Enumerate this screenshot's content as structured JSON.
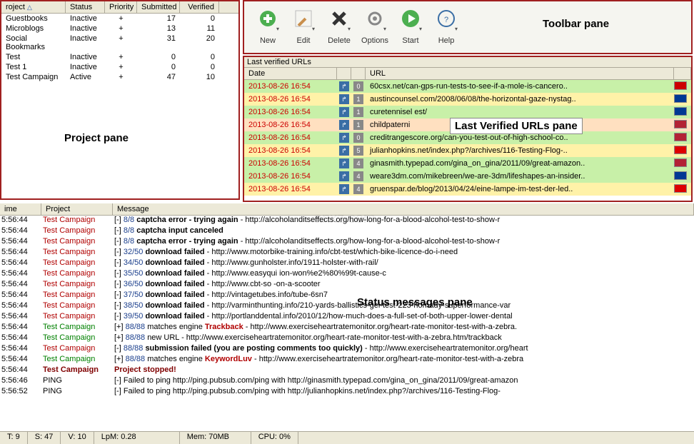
{
  "project_pane": {
    "label": "Project pane",
    "headers": {
      "project": "roject",
      "status": "Status",
      "priority": "Priority",
      "submitted": "Submitted",
      "verified": "Verified"
    },
    "rows": [
      {
        "project": "Guestbooks",
        "status": "Inactive",
        "priority": "+",
        "submitted": "17",
        "verified": "0"
      },
      {
        "project": "Microblogs",
        "status": "Inactive",
        "priority": "+",
        "submitted": "13",
        "verified": "11"
      },
      {
        "project": "Social Bookmarks",
        "status": "Inactive",
        "priority": "+",
        "submitted": "31",
        "verified": "20"
      },
      {
        "project": "Test",
        "status": "Inactive",
        "priority": "+",
        "submitted": "0",
        "verified": "0"
      },
      {
        "project": "Test 1",
        "status": "Inactive",
        "priority": "+",
        "submitted": "0",
        "verified": "0"
      },
      {
        "project": "Test Campaign",
        "status": "Active",
        "priority": "+",
        "submitted": "47",
        "verified": "10"
      }
    ]
  },
  "toolbar": {
    "label": "Toolbar pane",
    "buttons": [
      {
        "name": "new-button",
        "label": "New",
        "icon": "plus",
        "color": "#4caf50"
      },
      {
        "name": "edit-button",
        "label": "Edit",
        "icon": "pencil",
        "color": "#888"
      },
      {
        "name": "delete-button",
        "label": "Delete",
        "icon": "x",
        "color": "#555"
      },
      {
        "name": "options-button",
        "label": "Options",
        "icon": "gear",
        "color": "#888"
      },
      {
        "name": "start-button",
        "label": "Start",
        "icon": "play",
        "color": "#4caf50"
      },
      {
        "name": "help-button",
        "label": "Help",
        "icon": "help",
        "color": "#3a6ea5"
      }
    ]
  },
  "urls_pane": {
    "label": "Last Verified URLs pane",
    "title": "Last verified URLs",
    "headers": {
      "date": "Date",
      "url": "URL"
    },
    "rows": [
      {
        "date": "2013-08-26 16:54",
        "n": "0",
        "url": "60csx.net/can-gps-run-tests-to-see-if-a-mole-is-cancero..",
        "bg": "row-green",
        "flag": "#c00"
      },
      {
        "date": "2013-08-26 16:54",
        "n": "1",
        "url": "austincounsel.com/2008/06/08/the-horizontal-gaze-nystag..",
        "bg": "row-yellow",
        "flag": "#003893"
      },
      {
        "date": "2013-08-26 16:54",
        "n": "1",
        "url": "curetennisel                                    est/",
        "bg": "row-green",
        "flag": "#003893"
      },
      {
        "date": "2013-08-26 16:54",
        "n": "1",
        "url": "childpaterni",
        "bg": "row-peach",
        "flag": "#b22234"
      },
      {
        "date": "2013-08-26 16:54",
        "n": "0",
        "url": "creditrangescore.org/can-you-test-out-of-high-school-co..",
        "bg": "row-green",
        "flag": "#b22234"
      },
      {
        "date": "2013-08-26 16:54",
        "n": "5",
        "url": "julianhopkins.net/index.php?/archives/116-Testing-Flog-..",
        "bg": "row-yellow",
        "flag": "#d00"
      },
      {
        "date": "2013-08-26 16:54",
        "n": "4",
        "url": "ginasmith.typepad.com/gina_on_gina/2011/09/great-amazon..",
        "bg": "row-green",
        "flag": "#b22234"
      },
      {
        "date": "2013-08-26 16:54",
        "n": "4",
        "url": "weare3dm.com/mikebreen/we-are-3dm/lifeshapes-an-insider..",
        "bg": "row-green",
        "flag": "#003893"
      },
      {
        "date": "2013-08-26 16:54",
        "n": "4",
        "url": "gruenspar.de/blog/2013/04/24/eine-lampe-im-test-der-led..",
        "bg": "row-yellow",
        "flag": "#d00"
      }
    ]
  },
  "status_pane": {
    "label": "Status messages pane",
    "headers": {
      "time": "ime",
      "project": "Project",
      "message": "Message"
    },
    "rows": [
      {
        "time": "5:56:44",
        "proj": "Test Campaign",
        "projc": "tc-red",
        "prefix": "[-] ",
        "count": "8/8 ",
        "bold": "captcha error - trying again",
        "rest": " - http://alcoholanditseffects.org/how-long-for-a-blood-alcohol-test-to-show-r"
      },
      {
        "time": "5:56:44",
        "proj": "Test Campaign",
        "projc": "tc-red",
        "prefix": "[-] ",
        "count": "8/8 ",
        "bold": "captcha input canceled",
        "rest": ""
      },
      {
        "time": "5:56:44",
        "proj": "Test Campaign",
        "projc": "tc-red",
        "prefix": "[-] ",
        "count": "8/8 ",
        "bold": "captcha error - trying again",
        "rest": " - http://alcoholanditseffects.org/how-long-for-a-blood-alcohol-test-to-show-r"
      },
      {
        "time": "5:56:44",
        "proj": "Test Campaign",
        "projc": "tc-red",
        "prefix": "[-] ",
        "count": "32/50 ",
        "bold": "download failed",
        "rest": " - http://www.motorbike-training.info/cbt-test/which-bike-licence-do-i-need"
      },
      {
        "time": "5:56:44",
        "proj": "Test Campaign",
        "projc": "tc-red",
        "prefix": "[-] ",
        "count": "34/50 ",
        "bold": "download failed",
        "rest": " - http://www.gunholster.info/1911-holster-with-rail/"
      },
      {
        "time": "5:56:44",
        "proj": "Test Campaign",
        "projc": "tc-red",
        "prefix": "[-] ",
        "count": "35/50 ",
        "bold": "download failed",
        "rest": " - http://www.easyqui                                          ion-won%e2%80%99t-cause-c"
      },
      {
        "time": "5:56:44",
        "proj": "Test Campaign",
        "projc": "tc-red",
        "prefix": "[-] ",
        "count": "36/50 ",
        "bold": "download failed",
        "rest": " - http://www.cbt-so                                            -on-a-scooter"
      },
      {
        "time": "5:56:44",
        "proj": "Test Campaign",
        "projc": "tc-red",
        "prefix": "[-] ",
        "count": "37/50 ",
        "bold": "download failed",
        "rest": " - http://vintagetubes.info/tube-6sn7"
      },
      {
        "time": "5:56:44",
        "proj": "Test Campaign",
        "projc": "tc-red",
        "prefix": "[-] ",
        "count": "38/50 ",
        "bold": "download failed",
        "rest": " - http://varminthunting.info/210-yards-ballistics-gel-test-223-hornady-superformance-var"
      },
      {
        "time": "5:56:44",
        "proj": "Test Campaign",
        "projc": "tc-red",
        "prefix": "[-] ",
        "count": "39/50 ",
        "bold": "download failed",
        "rest": " - http://portlanddental.info/2010/12/how-much-does-a-full-set-of-both-upper-lower-dental"
      },
      {
        "time": "5:56:44",
        "proj": "Test Campaign",
        "projc": "tc-green",
        "prefix": "[+] ",
        "count": "88/88 ",
        "plain": "matches engine ",
        "kw": "Trackback",
        "rest": " - http://www.exerciseheartratemonitor.org/heart-rate-monitor-test-with-a-zebra."
      },
      {
        "time": "5:56:44",
        "proj": "Test Campaign",
        "projc": "tc-green",
        "prefix": "[+] ",
        "count": "88/88 ",
        "plain": "new URL - http://www.exerciseheartratemonitor.org/heart-rate-monitor-test-with-a-zebra.htm/trackback",
        "kw": "",
        "rest": ""
      },
      {
        "time": "5:56:44",
        "proj": "Test Campaign",
        "projc": "tc-red",
        "prefix": "[-] ",
        "count": "88/88 ",
        "bold": "submission failed (you are posting comments too quickly)",
        "rest": " - http://www.exerciseheartratemonitor.org/heart"
      },
      {
        "time": "5:56:44",
        "proj": "Test Campaign",
        "projc": "tc-green",
        "prefix": "[+] ",
        "count": "88/88 ",
        "plain": "matches engine ",
        "kw": "KeywordLuv",
        "rest": " - http://www.exerciseheartratemonitor.org/heart-rate-monitor-test-with-a-zebra"
      },
      {
        "time": "5:56:44",
        "proj": "Test Campaign",
        "projc": "tc-darkred",
        "stopped": "Project stopped!"
      },
      {
        "time": "5:56:46",
        "proj": "PING",
        "projc": "",
        "prefix": "[-] ",
        "plain": "Failed to ping http://ping.pubsub.com/ping with http://ginasmith.typepad.com/gina_on_gina/2011/09/great-amazon"
      },
      {
        "time": "5:56:52",
        "proj": "PING",
        "projc": "",
        "prefix": "[-] ",
        "plain": "Failed to ping http://ping.pubsub.com/ping with http://julianhopkins.net/index.php?/archives/116-Testing-Flog-"
      }
    ]
  },
  "footer": {
    "t": "T: 9",
    "s": "S: 47",
    "v": "V: 10",
    "lpm": "LpM: 0.28",
    "mem": "Mem: 70MB",
    "cpu": "CPU: 0%"
  }
}
